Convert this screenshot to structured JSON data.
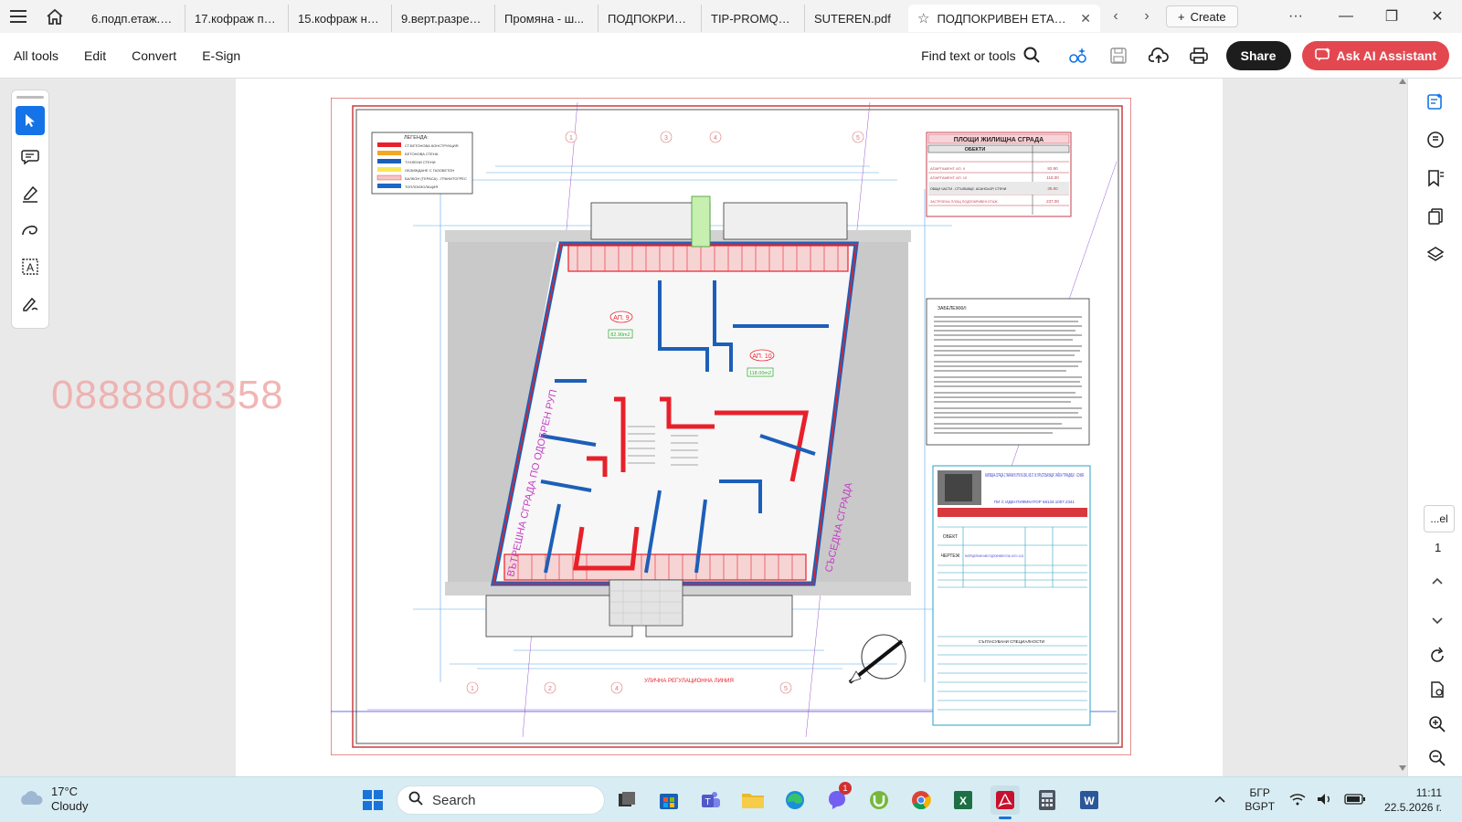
{
  "tabs": [
    {
      "label": "6.подп.етаж.р..."
    },
    {
      "label": "17.кофраж по..."
    },
    {
      "label": "15.кофраж на..."
    },
    {
      "label": "9.верт.разрез ..."
    },
    {
      "label": "Промяна - ш..."
    },
    {
      "label": "ПОДПОКРИВ..."
    },
    {
      "label": "TIP-PROMQN..."
    },
    {
      "label": "SUTEREN.pdf"
    }
  ],
  "active_tab": {
    "label": "ПОДПОКРИВЕН ЕТАЖ -..."
  },
  "create_label": "Create",
  "menu": {
    "all_tools": "All tools",
    "edit": "Edit",
    "convert": "Convert",
    "esign": "E-Sign"
  },
  "toolbar": {
    "find_label": "Find text or tools",
    "share_label": "Share",
    "ai_label": "Ask AI Assistant"
  },
  "watermark_phone": "0888808358",
  "page_nav": {
    "current": "...el",
    "total": "1"
  },
  "drawing": {
    "legend_title": "ЛЕГЕНДА:",
    "legend_items": [
      {
        "label": "СТ.БЕТОНОВА КОНСТРУКЦИЯ",
        "color": "#e8202a"
      },
      {
        "label": "БЕТОНОВА СТЕНА",
        "color": "#f5a623"
      },
      {
        "label": "ТУХЛЕНИ СТЕНИ",
        "color": "#1c5fb8"
      },
      {
        "label": "ОБЗИЖДАНЕ С ГАЗОБЕТОН",
        "color": "#f7e85a"
      },
      {
        "label": "БАЛКОН (ТЕРАСА) - ГРАНИТОГРЕС",
        "color": "#f4c6c6"
      },
      {
        "label": "ТОПЛОИЗОЛАЦИЯ",
        "color": "#1a66c9"
      }
    ],
    "areas_title": "ПЛОЩИ ЖИЛИЩНА СГРАДА",
    "areas_header": "ОБЕКТИ",
    "areas_rows": [
      {
        "label": "АПАРТАМЕНТ АП. 9",
        "value": "82.90"
      },
      {
        "label": "АПАРТАМЕНТ АП. 10",
        "value": "118.00"
      },
      {
        "label": "ОБЩИ ЧАСТИ - СТЪЛБИЩЕ, АСАНСЬОР, СТЕНИ",
        "value": "35.90"
      },
      {
        "label": "ЗАСТРОЕНА ПЛОЩ ПОДПОКРИВЕН ЕТАЖ",
        "value": "237.00"
      }
    ],
    "notes_title": "ЗАБЕЛЕЖКИ:",
    "title_block_heading": "ЖИЛИЩНА СГРАДА С ГАРАЖИ В УПИ III-2341, КВ.27, М.\"КРЪСТОВА ВАДА\", РАЙОН \"ТРИАДИЦА\" - СОФИЯ",
    "title_block_id": "ПИ С ИДЕНТИФИКАТОР 68134.1007.2341",
    "object_label": "ОБЕКТ",
    "drawing_label": "ЧЕРТЕЖ",
    "drawing_name": "РАЗПРЕДЕЛЕНИЕ НИВО ПОДПОКРИВЕН ЕТАЖ, КОТА +14.25",
    "apt9": "АП. 9",
    "apt10": "АП. 10",
    "apt9_area": "82.90m2",
    "apt10_area": "118.00m2",
    "left_side_text": "ВЪТРЕШНА СГРАДА ПО ОДОБРЕН РУП",
    "right_side_text": "СЪСЕДНА СГРАДА",
    "grid_top": [
      "1",
      "3",
      "4",
      "5"
    ],
    "grid_bottom": [
      "1",
      "2",
      "4",
      "5"
    ],
    "regulation_line": "УЛИЧНА РЕГУЛАЦИОННА ЛИНИЯ",
    "coordination_title": "СЪГЛАСУВАНИ СПЕЦИАЛНОСТИ"
  },
  "taskbar": {
    "weather_temp": "17°C",
    "weather_desc": "Cloudy",
    "search_placeholder": "Search",
    "lang_1": "БГР",
    "lang_2": "BGPT",
    "time": "11:11",
    "date": "22.5.2026 г.",
    "viber_badge": "1"
  },
  "colors": {
    "accent": "#1473e6",
    "share_bg": "#1d1d1d",
    "ai_bg": "#e34850",
    "taskbar": "#d8edf3"
  }
}
